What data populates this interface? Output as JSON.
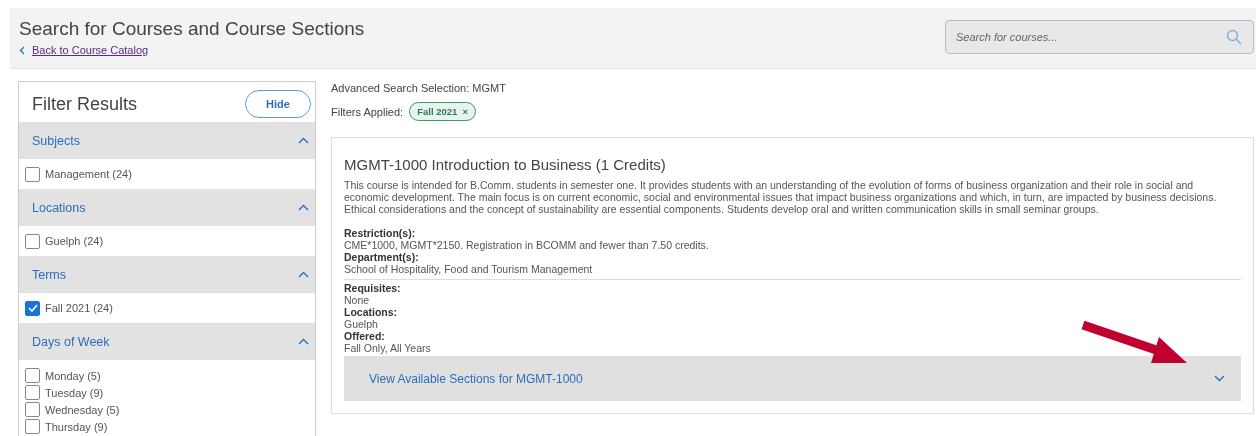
{
  "header": {
    "title": "Search for Courses and Course Sections",
    "back_link": "Back to Course Catalog",
    "search": {
      "placeholder": "Search for courses..."
    }
  },
  "filter_panel": {
    "title": "Filter Results",
    "hide_button": "Hide",
    "groups": [
      {
        "label": "Subjects",
        "expanded": true,
        "options": [
          {
            "label": "Management (24)",
            "checked": false
          }
        ]
      },
      {
        "label": "Locations",
        "expanded": true,
        "options": [
          {
            "label": "Guelph (24)",
            "checked": false
          }
        ]
      },
      {
        "label": "Terms",
        "expanded": true,
        "options": [
          {
            "label": "Fall 2021 (24)",
            "checked": true
          }
        ]
      },
      {
        "label": "Days of Week",
        "expanded": true,
        "options": [
          {
            "label": "Monday (5)",
            "checked": false
          },
          {
            "label": "Tuesday (9)",
            "checked": false
          },
          {
            "label": "Wednesday (5)",
            "checked": false
          },
          {
            "label": "Thursday (9)",
            "checked": false
          }
        ]
      }
    ]
  },
  "results": {
    "advanced_search": "Advanced Search Selection: MGMT",
    "filters_label": "Filters Applied:",
    "filter_chips": [
      {
        "label": "Fall 2021",
        "remove": "×"
      }
    ],
    "course": {
      "title": "MGMT-1000 Introduction to Business (1 Credits)",
      "description": "This course is intended for B.Comm. students in semester one. It provides students with an understanding of the evolution of forms of business organization and their role in social and economic development. The main focus is on current economic, social and environmental issues that impact business organizations and which, in turn, are impacted by business decisions. Ethical considerations and the concept of sustainability are essential components. Students develop oral and written communication skills in small seminar groups.",
      "details": [
        {
          "label": "Restriction(s):",
          "value": "CME*1000, MGMT*2150. Registration in BCOMM and fewer than 7.50 credits."
        },
        {
          "label": "Department(s):",
          "value": "School of Hospitality, Food and Tourism Management"
        }
      ],
      "more_details": [
        {
          "label": "Requisites:",
          "value": "None"
        },
        {
          "label": "Locations:",
          "value": "Guelph"
        },
        {
          "label": "Offered:",
          "value": "Fall Only, All Years"
        }
      ],
      "sections_toggle": {
        "label": "View Available Sections for MGMT-1000",
        "expanded": false
      }
    }
  }
}
